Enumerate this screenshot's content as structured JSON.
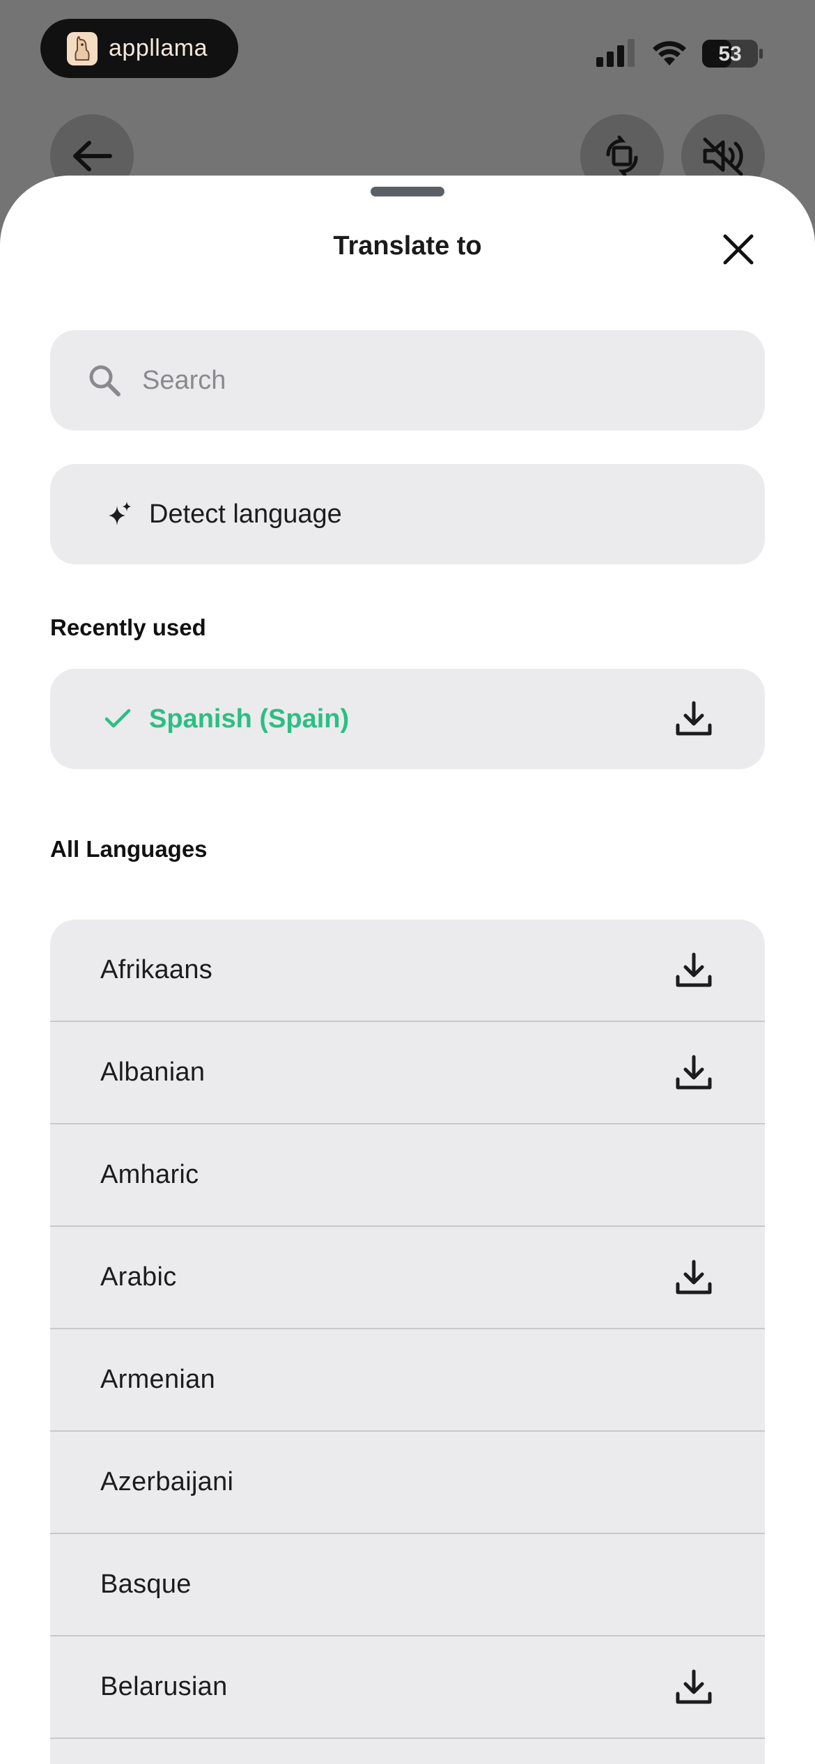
{
  "status_bar": {
    "app_name": "appllama",
    "battery_level": "53"
  },
  "sheet": {
    "title": "Translate to"
  },
  "search": {
    "placeholder": "Search",
    "value": ""
  },
  "detect": {
    "label": "Detect language"
  },
  "recent": {
    "heading": "Recently used",
    "items": [
      {
        "label": "Spanish (Spain)",
        "selected": true,
        "downloadable": true
      }
    ]
  },
  "all_languages": {
    "heading": "All Languages",
    "items": [
      {
        "label": "Afrikaans",
        "downloadable": true
      },
      {
        "label": "Albanian",
        "downloadable": true
      },
      {
        "label": "Amharic",
        "downloadable": false
      },
      {
        "label": "Arabic",
        "downloadable": true
      },
      {
        "label": "Armenian",
        "downloadable": false
      },
      {
        "label": "Azerbaijani",
        "downloadable": false
      },
      {
        "label": "Basque",
        "downloadable": false
      },
      {
        "label": "Belarusian",
        "downloadable": true
      }
    ]
  },
  "icons": {
    "back": "arrow-left-icon",
    "rotate": "rotate-screen-icon",
    "mute": "speaker-muted-icon",
    "close": "close-icon",
    "search": "search-icon",
    "detect": "sparkle-icon",
    "selected": "checkmark-icon",
    "download": "download-icon"
  },
  "colors": {
    "accent_green": "#2bbf83",
    "row_background": "#ebebed",
    "dim_background": "#747474"
  }
}
